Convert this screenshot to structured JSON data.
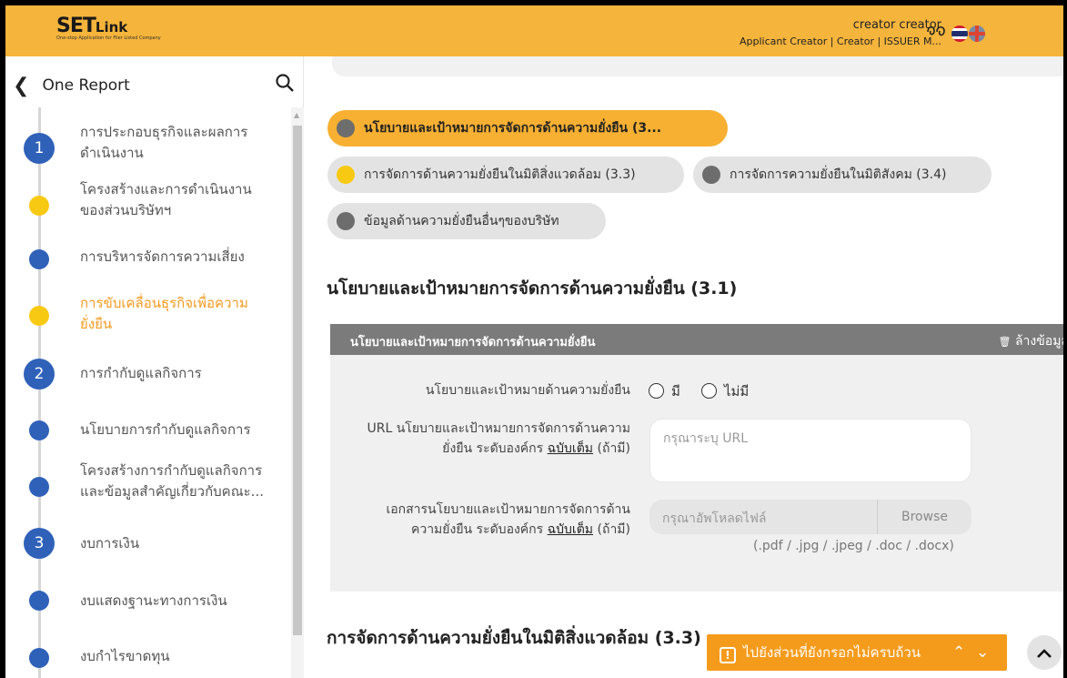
{
  "header": {
    "logo_set": "SET",
    "logo_link": "Link",
    "logo_tagline": "One-stop Application for Filer Listed Company",
    "user_name": "creator creator",
    "user_roles": "Applicant Creator | Creator | ISSUER M..."
  },
  "sidebar": {
    "title": "One Report",
    "items": [
      {
        "number": "1",
        "label1": "การประกอบธุรกิจและผลการ",
        "label2": "ดำเนินงาน"
      },
      {
        "label1": "โครงสร้างและการดำเนินงาน",
        "label2": "ของส่วนบริษัทฯ"
      },
      {
        "label1": "การบริหารจัดการความเสี่ยง"
      },
      {
        "label1": "การขับเคลื่อนธุรกิจเพื่อความ",
        "label2": "ยั่งยืน"
      },
      {
        "number": "2",
        "label1": "การกำกับดูแลกิจการ"
      },
      {
        "label1": "นโยบายการกำกับดูแลกิจการ"
      },
      {
        "label1": "โครงสร้างการกำกับดูแลกิจการ",
        "label2": "และข้อมูลสำคัญเกี่ยวกับคณะ..."
      },
      {
        "number": "3",
        "label1": "งบการเงิน"
      },
      {
        "label1": "งบแสดงฐานะทางการเงิน"
      },
      {
        "label1": "งบกำไรขาดทุน"
      }
    ]
  },
  "chips": [
    "นโยบายและเป้าหมายการจัดการด้านความยั่งยืน (3...",
    "การจัดการด้านความยั่งยืนในมิติสิ่งแวดล้อม (3.3)",
    "การจัดการความยั่งยืนในมิติสังคม (3.4)",
    "ข้อมูลด้านความยั่งยืนอื่นๆของบริษัท"
  ],
  "section1": {
    "title": "นโยบายและเป้าหมายการจัดการด้านความยั่งยืน (3.1)",
    "card_title": "นโยบายและเป้าหมายการจัดการด้านความยั่งยืน",
    "clear_label": "ล้างข้อมูล",
    "policy_label": "นโยบายและเป้าหมายด้านความยั่งยืน",
    "radio_yes": "มี",
    "radio_no": "ไม่มี",
    "url_label1": "URL นโยบายและเป้าหมายการจัดการด้านความ",
    "url_label2": "ยั่งยืน ระดับองค์กร",
    "full_version": "ฉบับเต็ม",
    "optional": "(ถ้ามี)",
    "url_placeholder": "กรุณาระบุ URL",
    "doc_label1": "เอกสารนโยบายและเป้าหมายการจัดการด้าน",
    "doc_label2": "ความยั่งยืน ระดับองค์กร",
    "file_placeholder": "กรุณาอัพโหลดไฟล์",
    "browse": "Browse",
    "file_types": "(.pdf / .jpg / .jpeg / .doc / .docx)"
  },
  "section2": {
    "title": "การจัดการด้านความยั่งยืนในมิติสิ่งแวดล้อม (3.3)"
  },
  "float_bar": {
    "label": "ไปยังส่วนที่ยังกรอกไม่ครบถ้วน"
  },
  "colors": {
    "accent": "#f5b43b",
    "primary": "#2f61b9",
    "active_text": "#f39a1e"
  }
}
